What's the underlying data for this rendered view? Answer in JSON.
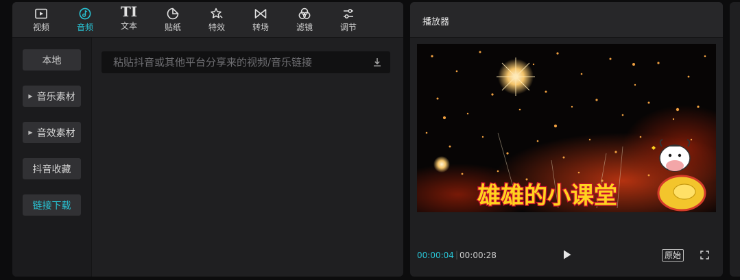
{
  "toolbar": {
    "items": [
      {
        "label": "视频",
        "icon": "video-icon"
      },
      {
        "label": "音频",
        "icon": "audio-icon",
        "active": true
      },
      {
        "label": "文本",
        "icon": "text-icon",
        "glyph": "TI"
      },
      {
        "label": "贴纸",
        "icon": "sticker-icon"
      },
      {
        "label": "特效",
        "icon": "effects-icon"
      },
      {
        "label": "转场",
        "icon": "transition-icon"
      },
      {
        "label": "滤镜",
        "icon": "filter-icon"
      },
      {
        "label": "调节",
        "icon": "adjust-icon"
      }
    ]
  },
  "sidebar": {
    "items": [
      {
        "label": "本地",
        "expandable": false
      },
      {
        "label": "音乐素材",
        "expandable": true
      },
      {
        "label": "音效素材",
        "expandable": true
      },
      {
        "label": "抖音收藏",
        "expandable": false
      },
      {
        "label": "链接下载",
        "expandable": false,
        "active": true
      }
    ]
  },
  "link_input": {
    "placeholder": "粘贴抖音或其他平台分享来的视频/音乐链接",
    "value": ""
  },
  "player": {
    "title": "播放器",
    "caption": "雄雄的小课堂",
    "current_time": "00:00:04",
    "total_time": "00:00:28",
    "ratio_label": "原始"
  },
  "colors": {
    "accent": "#29c3d4",
    "panel_bg": "#1f1f21",
    "caption_yellow": "#ffd21f",
    "caption_outline": "#c8102e"
  }
}
